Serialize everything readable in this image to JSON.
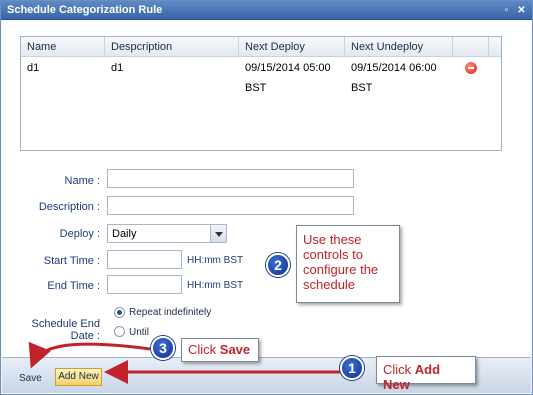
{
  "window": {
    "title": "Schedule Categorization Rule",
    "min_glyph": "▫",
    "close_glyph": "✕"
  },
  "grid": {
    "columns": [
      "Name",
      "Despcription",
      "Next Deploy",
      "Next Undeploy",
      ""
    ],
    "rows": [
      {
        "name": "d1",
        "description": "d1",
        "next_deploy": "09/15/2014 05:00 BST",
        "next_undeploy": "09/15/2014 06:00 BST"
      }
    ]
  },
  "form": {
    "name_label": "Name :",
    "name_value": "",
    "description_label": "Description :",
    "description_value": "",
    "deploy_label": "Deploy :",
    "deploy_value": "Daily",
    "start_time_label": "Start Time :",
    "start_time_value": "",
    "start_time_hint": "HH:mm BST",
    "end_time_label": "End Time :",
    "end_time_value": "",
    "end_time_hint": "HH:mm BST",
    "end_date_label": "Schedule End Date :",
    "end_date_options": [
      {
        "label": "Repeat indefinitely",
        "selected": true
      },
      {
        "label": "Until",
        "selected": false
      }
    ]
  },
  "footer": {
    "save_label": "Save",
    "add_new_label": "Add New"
  },
  "annotations": {
    "callout_2_line1": "Use these",
    "callout_2_line2": "controls to",
    "callout_2_line3": "configure the",
    "callout_2_line4": "schedule",
    "callout_3_prefix": "Click ",
    "callout_3_bold": "Save",
    "callout_1_prefix": "Click ",
    "callout_1_bold": "Add New",
    "badge_1": "1",
    "badge_2": "2",
    "badge_3": "3",
    "accent_color": "#c0232b",
    "badge_color": "#1f45b5"
  }
}
